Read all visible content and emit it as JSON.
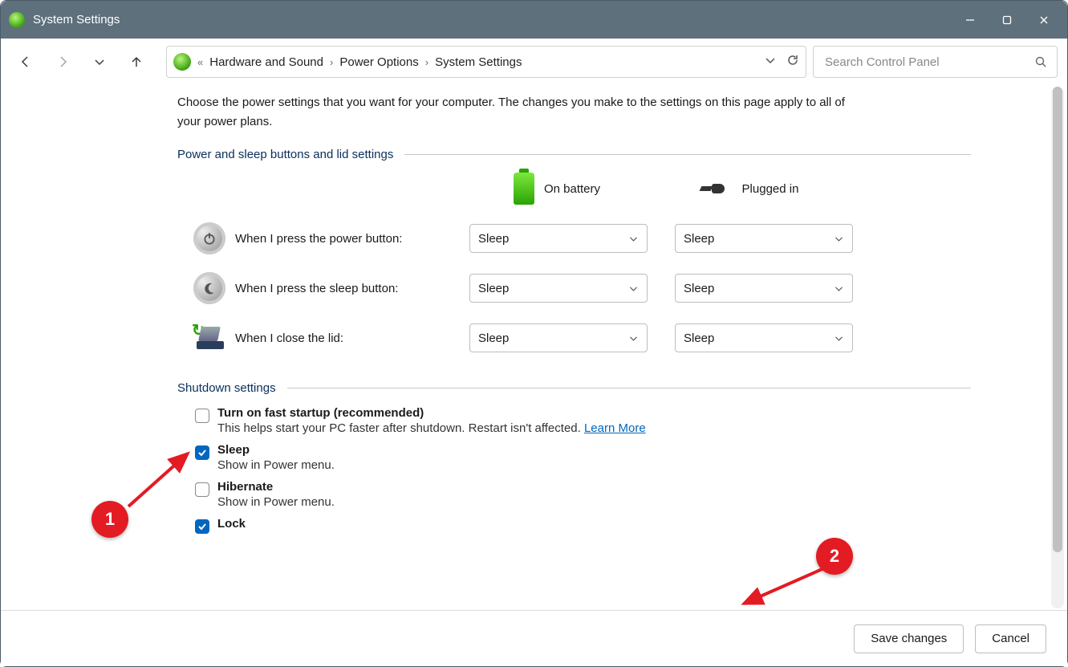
{
  "window": {
    "title": "System Settings"
  },
  "breadcrumb": {
    "items": [
      "Hardware and Sound",
      "Power Options",
      "System Settings"
    ]
  },
  "search": {
    "placeholder": "Search Control Panel"
  },
  "intro": "Choose the power settings that you want for your computer. The changes you make to the settings on this page apply to all of your power plans.",
  "section1": {
    "title": "Power and sleep buttons and lid settings",
    "cols": {
      "battery": "On battery",
      "plugged": "Plugged in"
    },
    "rows": [
      {
        "label": "When I press the power button:",
        "battery": "Sleep",
        "plugged": "Sleep"
      },
      {
        "label": "When I press the sleep button:",
        "battery": "Sleep",
        "plugged": "Sleep"
      },
      {
        "label": "When I close the lid:",
        "battery": "Sleep",
        "plugged": "Sleep"
      }
    ]
  },
  "section2": {
    "title": "Shutdown settings",
    "items": [
      {
        "title": "Turn on fast startup (recommended)",
        "desc": "This helps start your PC faster after shutdown. Restart isn't affected. ",
        "link": "Learn More",
        "checked": false
      },
      {
        "title": "Sleep",
        "desc": "Show in Power menu.",
        "checked": true
      },
      {
        "title": "Hibernate",
        "desc": "Show in Power menu.",
        "checked": false
      },
      {
        "title": "Lock",
        "desc": "",
        "checked": true
      }
    ]
  },
  "footer": {
    "save": "Save changes",
    "cancel": "Cancel"
  },
  "annotations": {
    "a1": "1",
    "a2": "2"
  }
}
